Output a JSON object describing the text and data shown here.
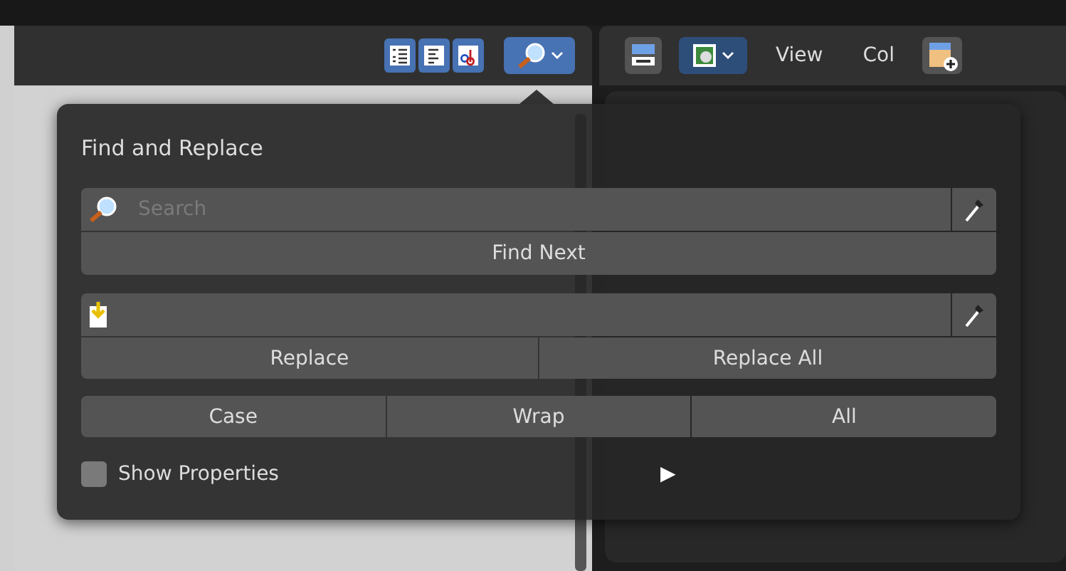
{
  "text_editor_header": {
    "toggles": [
      {
        "kind": "line-numbers",
        "on": true
      },
      {
        "kind": "word-wrap",
        "on": true
      },
      {
        "kind": "syntax",
        "on": true
      }
    ],
    "find_button": {
      "selected": true
    }
  },
  "outliner_header": {
    "menus": [
      "View",
      "Col"
    ]
  },
  "find_popup": {
    "title": "Find and Replace",
    "search": {
      "placeholder": "Search"
    },
    "find_next": "Find Next",
    "replace_buttons": [
      "Replace",
      "Replace All"
    ],
    "options": [
      {
        "label": "Case",
        "on": false
      },
      {
        "label": "Wrap",
        "on": false
      },
      {
        "label": "All",
        "on": false
      }
    ],
    "show_properties": {
      "label": "Show Properties",
      "checked": false
    },
    "arrow": "▶"
  }
}
